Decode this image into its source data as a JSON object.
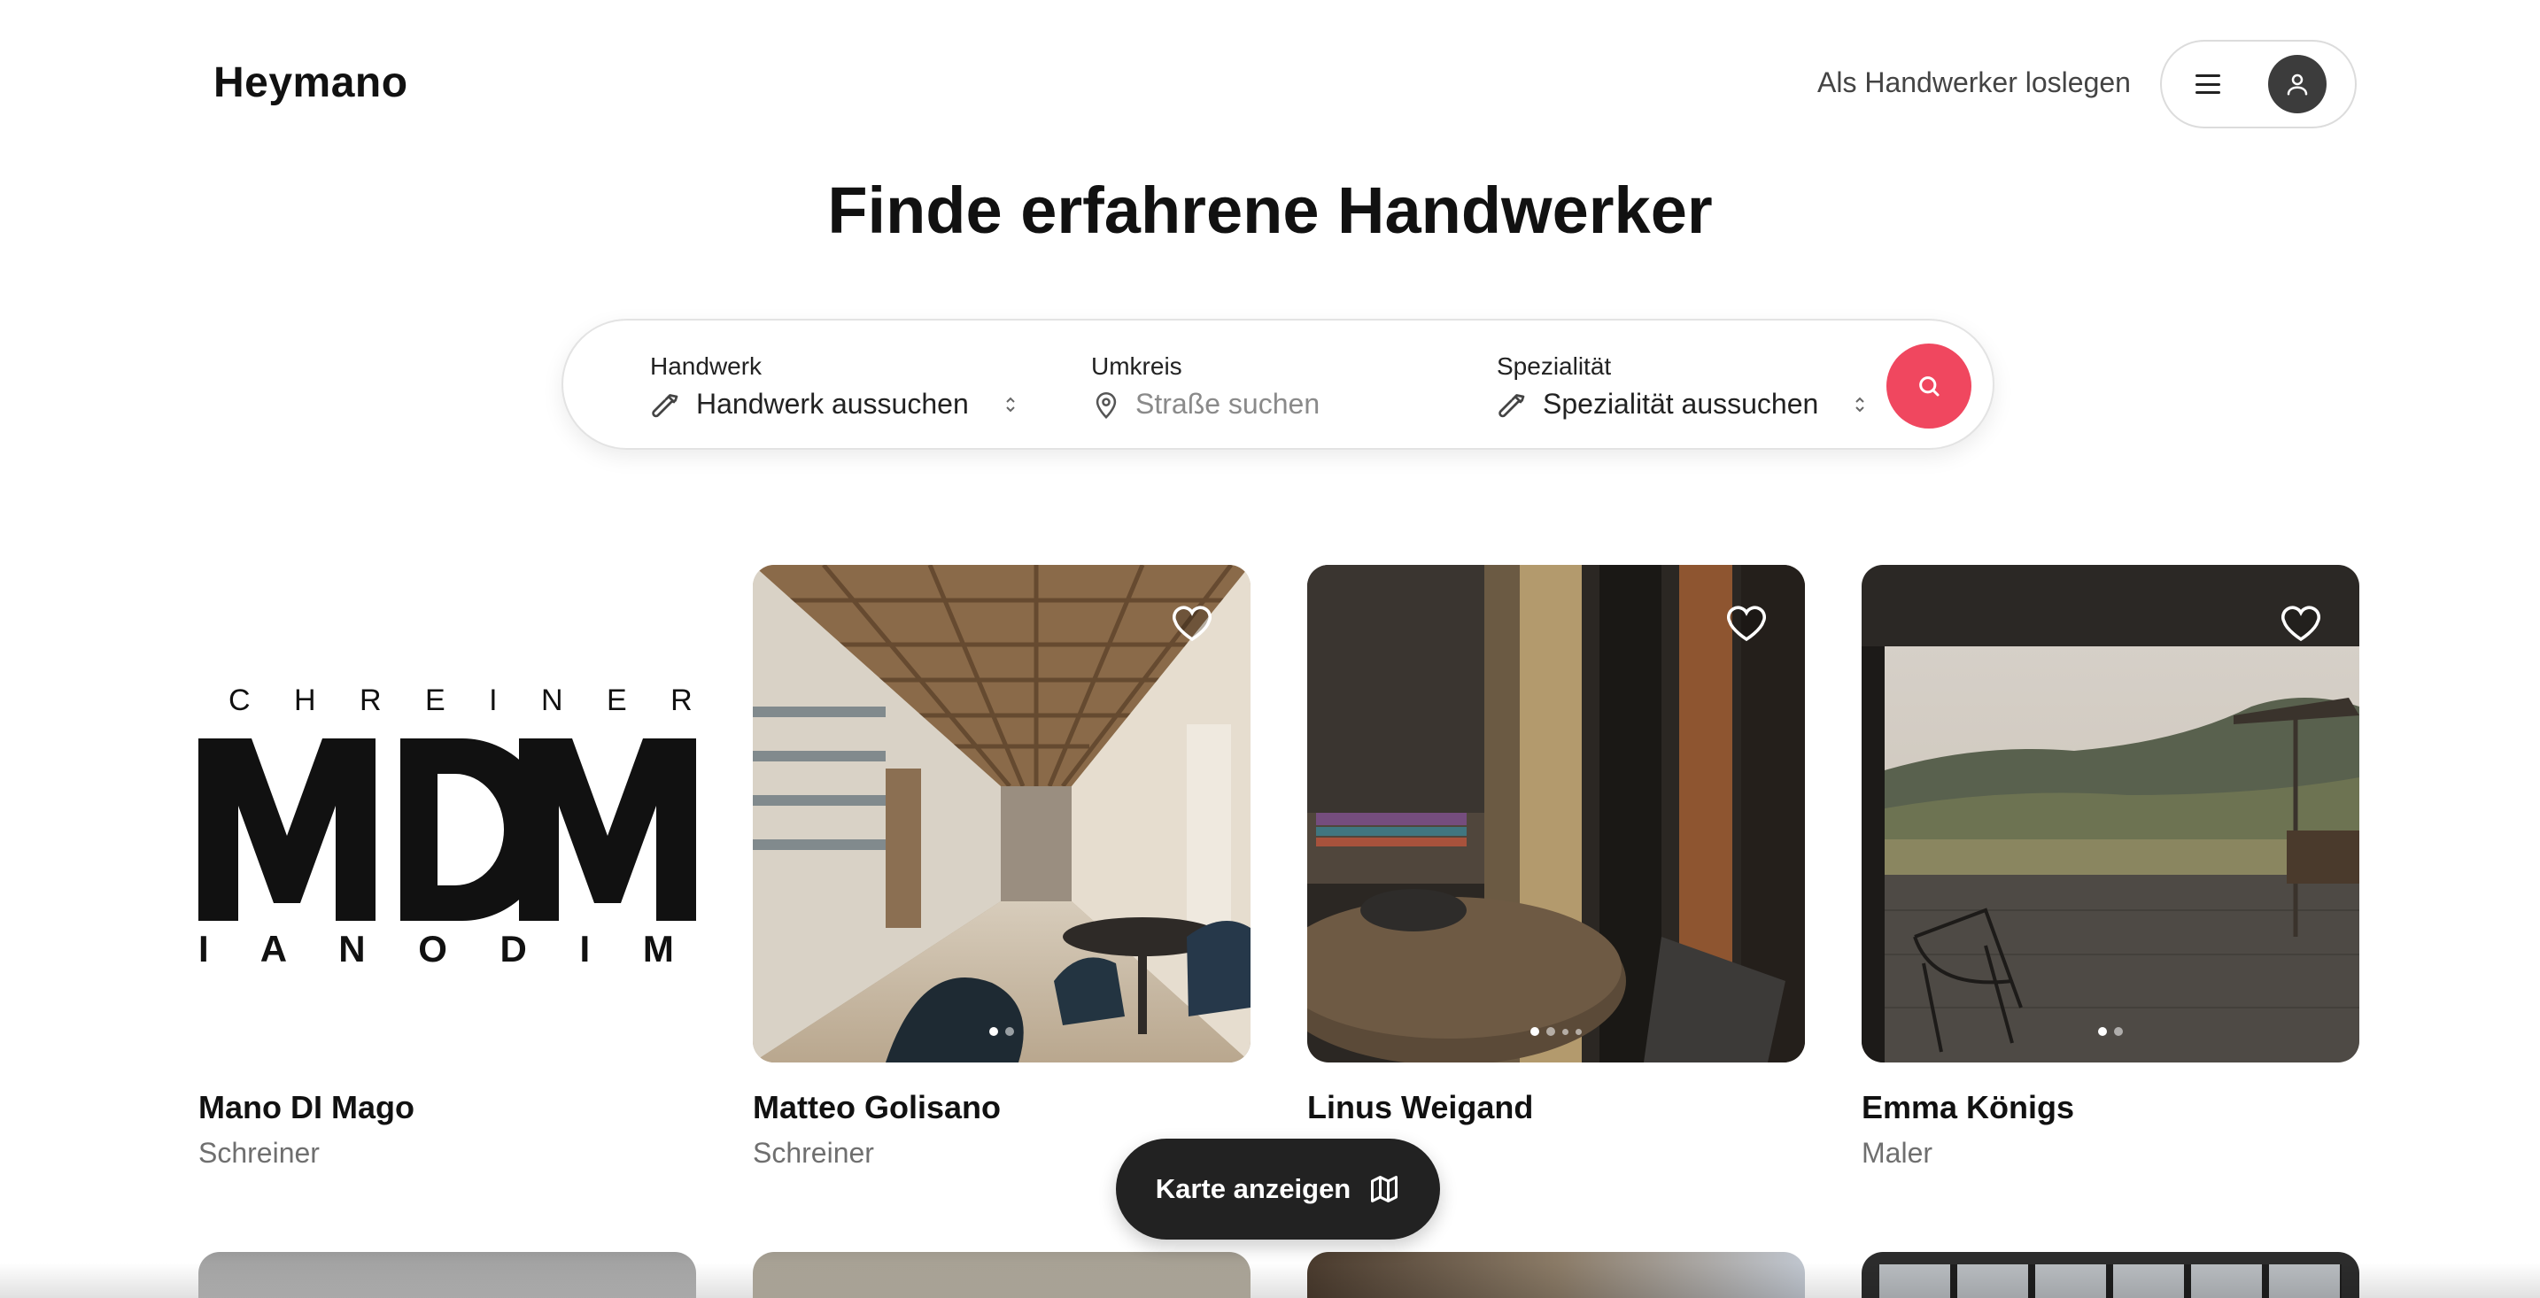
{
  "header": {
    "logo": "Heymano",
    "cta_link": "Als Handwerker loslegen"
  },
  "hero": {
    "title": "Finde erfahrene Handwerker"
  },
  "search": {
    "handwerk": {
      "label": "Handwerk",
      "value": "Handwerk aussuchen"
    },
    "umkreis": {
      "label": "Umkreis",
      "placeholder": "Straße suchen"
    },
    "spezialitaet": {
      "label": "Spezialität",
      "value": "Spezialität aussuchen"
    },
    "accent_color": "#f0475f"
  },
  "listings": [
    {
      "name": "Mano DI Mago",
      "trade": "Schreiner",
      "logo_text": {
        "top": "C H R E I N E R E",
        "big": "MDM",
        "bottom": "I A N O   D I   M A G"
      }
    },
    {
      "name": "Matteo Golisano",
      "trade": "Schreiner",
      "image_count": 2,
      "active_image": 0
    },
    {
      "name": "Linus Weigand",
      "trade": "",
      "image_count": 4,
      "active_image": 0
    },
    {
      "name": "Emma Königs",
      "trade": "Maler",
      "image_count": 2,
      "active_image": 0
    }
  ],
  "map_button": {
    "label": "Karte anzeigen"
  }
}
